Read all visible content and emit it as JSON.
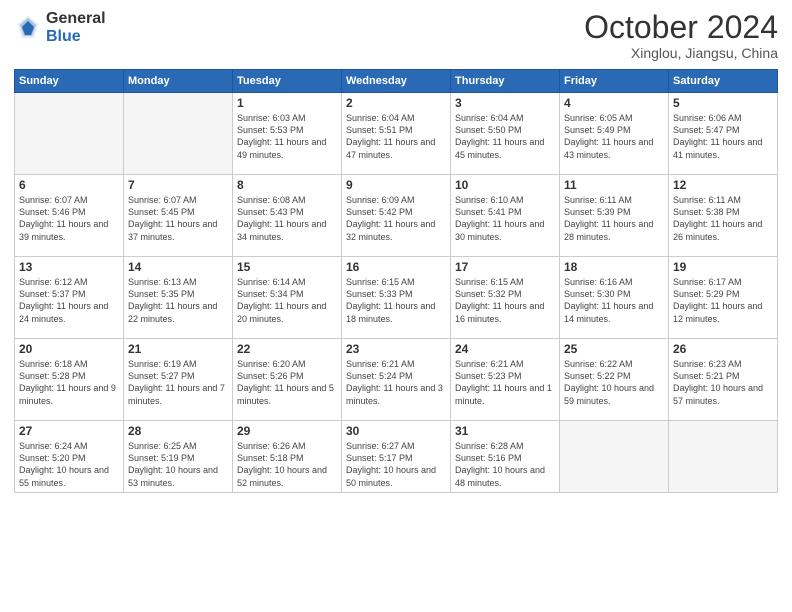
{
  "header": {
    "logo_general": "General",
    "logo_blue": "Blue",
    "month_title": "October 2024",
    "subtitle": "Xinglou, Jiangsu, China"
  },
  "days_of_week": [
    "Sunday",
    "Monday",
    "Tuesday",
    "Wednesday",
    "Thursday",
    "Friday",
    "Saturday"
  ],
  "weeks": [
    [
      {
        "day": "",
        "info": ""
      },
      {
        "day": "",
        "info": ""
      },
      {
        "day": "1",
        "info": "Sunrise: 6:03 AM\nSunset: 5:53 PM\nDaylight: 11 hours and 49 minutes."
      },
      {
        "day": "2",
        "info": "Sunrise: 6:04 AM\nSunset: 5:51 PM\nDaylight: 11 hours and 47 minutes."
      },
      {
        "day": "3",
        "info": "Sunrise: 6:04 AM\nSunset: 5:50 PM\nDaylight: 11 hours and 45 minutes."
      },
      {
        "day": "4",
        "info": "Sunrise: 6:05 AM\nSunset: 5:49 PM\nDaylight: 11 hours and 43 minutes."
      },
      {
        "day": "5",
        "info": "Sunrise: 6:06 AM\nSunset: 5:47 PM\nDaylight: 11 hours and 41 minutes."
      }
    ],
    [
      {
        "day": "6",
        "info": "Sunrise: 6:07 AM\nSunset: 5:46 PM\nDaylight: 11 hours and 39 minutes."
      },
      {
        "day": "7",
        "info": "Sunrise: 6:07 AM\nSunset: 5:45 PM\nDaylight: 11 hours and 37 minutes."
      },
      {
        "day": "8",
        "info": "Sunrise: 6:08 AM\nSunset: 5:43 PM\nDaylight: 11 hours and 34 minutes."
      },
      {
        "day": "9",
        "info": "Sunrise: 6:09 AM\nSunset: 5:42 PM\nDaylight: 11 hours and 32 minutes."
      },
      {
        "day": "10",
        "info": "Sunrise: 6:10 AM\nSunset: 5:41 PM\nDaylight: 11 hours and 30 minutes."
      },
      {
        "day": "11",
        "info": "Sunrise: 6:11 AM\nSunset: 5:39 PM\nDaylight: 11 hours and 28 minutes."
      },
      {
        "day": "12",
        "info": "Sunrise: 6:11 AM\nSunset: 5:38 PM\nDaylight: 11 hours and 26 minutes."
      }
    ],
    [
      {
        "day": "13",
        "info": "Sunrise: 6:12 AM\nSunset: 5:37 PM\nDaylight: 11 hours and 24 minutes."
      },
      {
        "day": "14",
        "info": "Sunrise: 6:13 AM\nSunset: 5:35 PM\nDaylight: 11 hours and 22 minutes."
      },
      {
        "day": "15",
        "info": "Sunrise: 6:14 AM\nSunset: 5:34 PM\nDaylight: 11 hours and 20 minutes."
      },
      {
        "day": "16",
        "info": "Sunrise: 6:15 AM\nSunset: 5:33 PM\nDaylight: 11 hours and 18 minutes."
      },
      {
        "day": "17",
        "info": "Sunrise: 6:15 AM\nSunset: 5:32 PM\nDaylight: 11 hours and 16 minutes."
      },
      {
        "day": "18",
        "info": "Sunrise: 6:16 AM\nSunset: 5:30 PM\nDaylight: 11 hours and 14 minutes."
      },
      {
        "day": "19",
        "info": "Sunrise: 6:17 AM\nSunset: 5:29 PM\nDaylight: 11 hours and 12 minutes."
      }
    ],
    [
      {
        "day": "20",
        "info": "Sunrise: 6:18 AM\nSunset: 5:28 PM\nDaylight: 11 hours and 9 minutes."
      },
      {
        "day": "21",
        "info": "Sunrise: 6:19 AM\nSunset: 5:27 PM\nDaylight: 11 hours and 7 minutes."
      },
      {
        "day": "22",
        "info": "Sunrise: 6:20 AM\nSunset: 5:26 PM\nDaylight: 11 hours and 5 minutes."
      },
      {
        "day": "23",
        "info": "Sunrise: 6:21 AM\nSunset: 5:24 PM\nDaylight: 11 hours and 3 minutes."
      },
      {
        "day": "24",
        "info": "Sunrise: 6:21 AM\nSunset: 5:23 PM\nDaylight: 11 hours and 1 minute."
      },
      {
        "day": "25",
        "info": "Sunrise: 6:22 AM\nSunset: 5:22 PM\nDaylight: 10 hours and 59 minutes."
      },
      {
        "day": "26",
        "info": "Sunrise: 6:23 AM\nSunset: 5:21 PM\nDaylight: 10 hours and 57 minutes."
      }
    ],
    [
      {
        "day": "27",
        "info": "Sunrise: 6:24 AM\nSunset: 5:20 PM\nDaylight: 10 hours and 55 minutes."
      },
      {
        "day": "28",
        "info": "Sunrise: 6:25 AM\nSunset: 5:19 PM\nDaylight: 10 hours and 53 minutes."
      },
      {
        "day": "29",
        "info": "Sunrise: 6:26 AM\nSunset: 5:18 PM\nDaylight: 10 hours and 52 minutes."
      },
      {
        "day": "30",
        "info": "Sunrise: 6:27 AM\nSunset: 5:17 PM\nDaylight: 10 hours and 50 minutes."
      },
      {
        "day": "31",
        "info": "Sunrise: 6:28 AM\nSunset: 5:16 PM\nDaylight: 10 hours and 48 minutes."
      },
      {
        "day": "",
        "info": ""
      },
      {
        "day": "",
        "info": ""
      }
    ]
  ]
}
